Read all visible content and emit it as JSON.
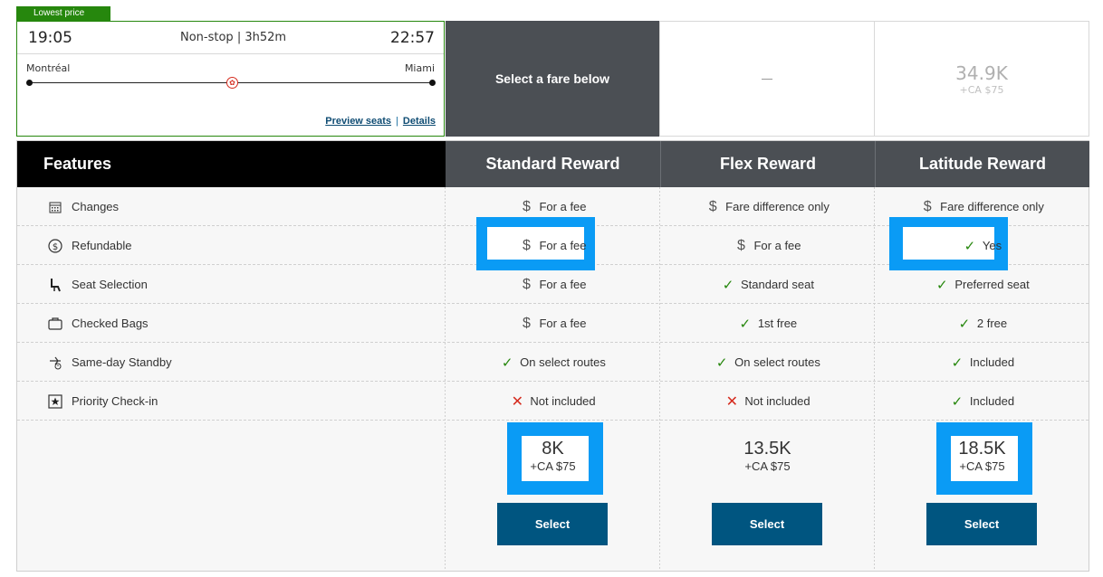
{
  "badge": "Lowest price",
  "flight": {
    "departure_time": "19:05",
    "arrival_time": "22:57",
    "duration": "Non-stop | 3h52m",
    "origin": "Montréal",
    "destination": "Miami",
    "preview_seats": "Preview seats",
    "separator": "|",
    "details": "Details"
  },
  "top": {
    "select_prompt": "Select a fare below",
    "flex_dash": "—",
    "latitude_points": "34.9K",
    "latitude_cash": "+CA $75"
  },
  "table": {
    "features_header": "Features",
    "fares": [
      {
        "name": "Standard Reward",
        "points": "8K",
        "cash": "+CA $75",
        "button": "Select"
      },
      {
        "name": "Flex Reward",
        "points": "13.5K",
        "cash": "+CA $75",
        "button": "Select"
      },
      {
        "name": "Latitude Reward",
        "points": "18.5K",
        "cash": "+CA $75",
        "button": "Select"
      }
    ],
    "rows": [
      {
        "feature": "Changes",
        "icon": "calendar-icon",
        "std": {
          "sym": "dollar",
          "text": "For a fee"
        },
        "flex": {
          "sym": "dollar",
          "text": "Fare difference only"
        },
        "lat": {
          "sym": "dollar",
          "text": "Fare difference only"
        }
      },
      {
        "feature": "Refundable",
        "icon": "refund-icon",
        "std": {
          "sym": "dollar",
          "text": "For a fee"
        },
        "flex": {
          "sym": "dollar",
          "text": "For a fee"
        },
        "lat": {
          "sym": "check",
          "text": "Yes"
        }
      },
      {
        "feature": "Seat Selection",
        "icon": "seat-icon",
        "std": {
          "sym": "dollar",
          "text": "For a fee"
        },
        "flex": {
          "sym": "check",
          "text": "Standard seat"
        },
        "lat": {
          "sym": "check",
          "text": "Preferred seat"
        }
      },
      {
        "feature": "Checked Bags",
        "icon": "bag-icon",
        "std": {
          "sym": "dollar",
          "text": "For a fee"
        },
        "flex": {
          "sym": "check",
          "text": "1st free"
        },
        "lat": {
          "sym": "check",
          "text": "2 free"
        }
      },
      {
        "feature": "Same-day Standby",
        "icon": "standby-icon",
        "std": {
          "sym": "check",
          "text": "On select routes"
        },
        "flex": {
          "sym": "check",
          "text": "On select routes"
        },
        "lat": {
          "sym": "check",
          "text": "Included"
        }
      },
      {
        "feature": "Priority Check-in",
        "icon": "priority-icon",
        "std": {
          "sym": "cross",
          "text": "Not included"
        },
        "flex": {
          "sym": "cross",
          "text": "Not included"
        },
        "lat": {
          "sym": "check",
          "text": "Included"
        }
      }
    ]
  },
  "colors": {
    "accent_green": "#26870d",
    "header_dark": "#4b4f54",
    "button_blue": "#005580",
    "highlight_blue": "#0a9bf5",
    "cross_red": "#d52b1e"
  }
}
